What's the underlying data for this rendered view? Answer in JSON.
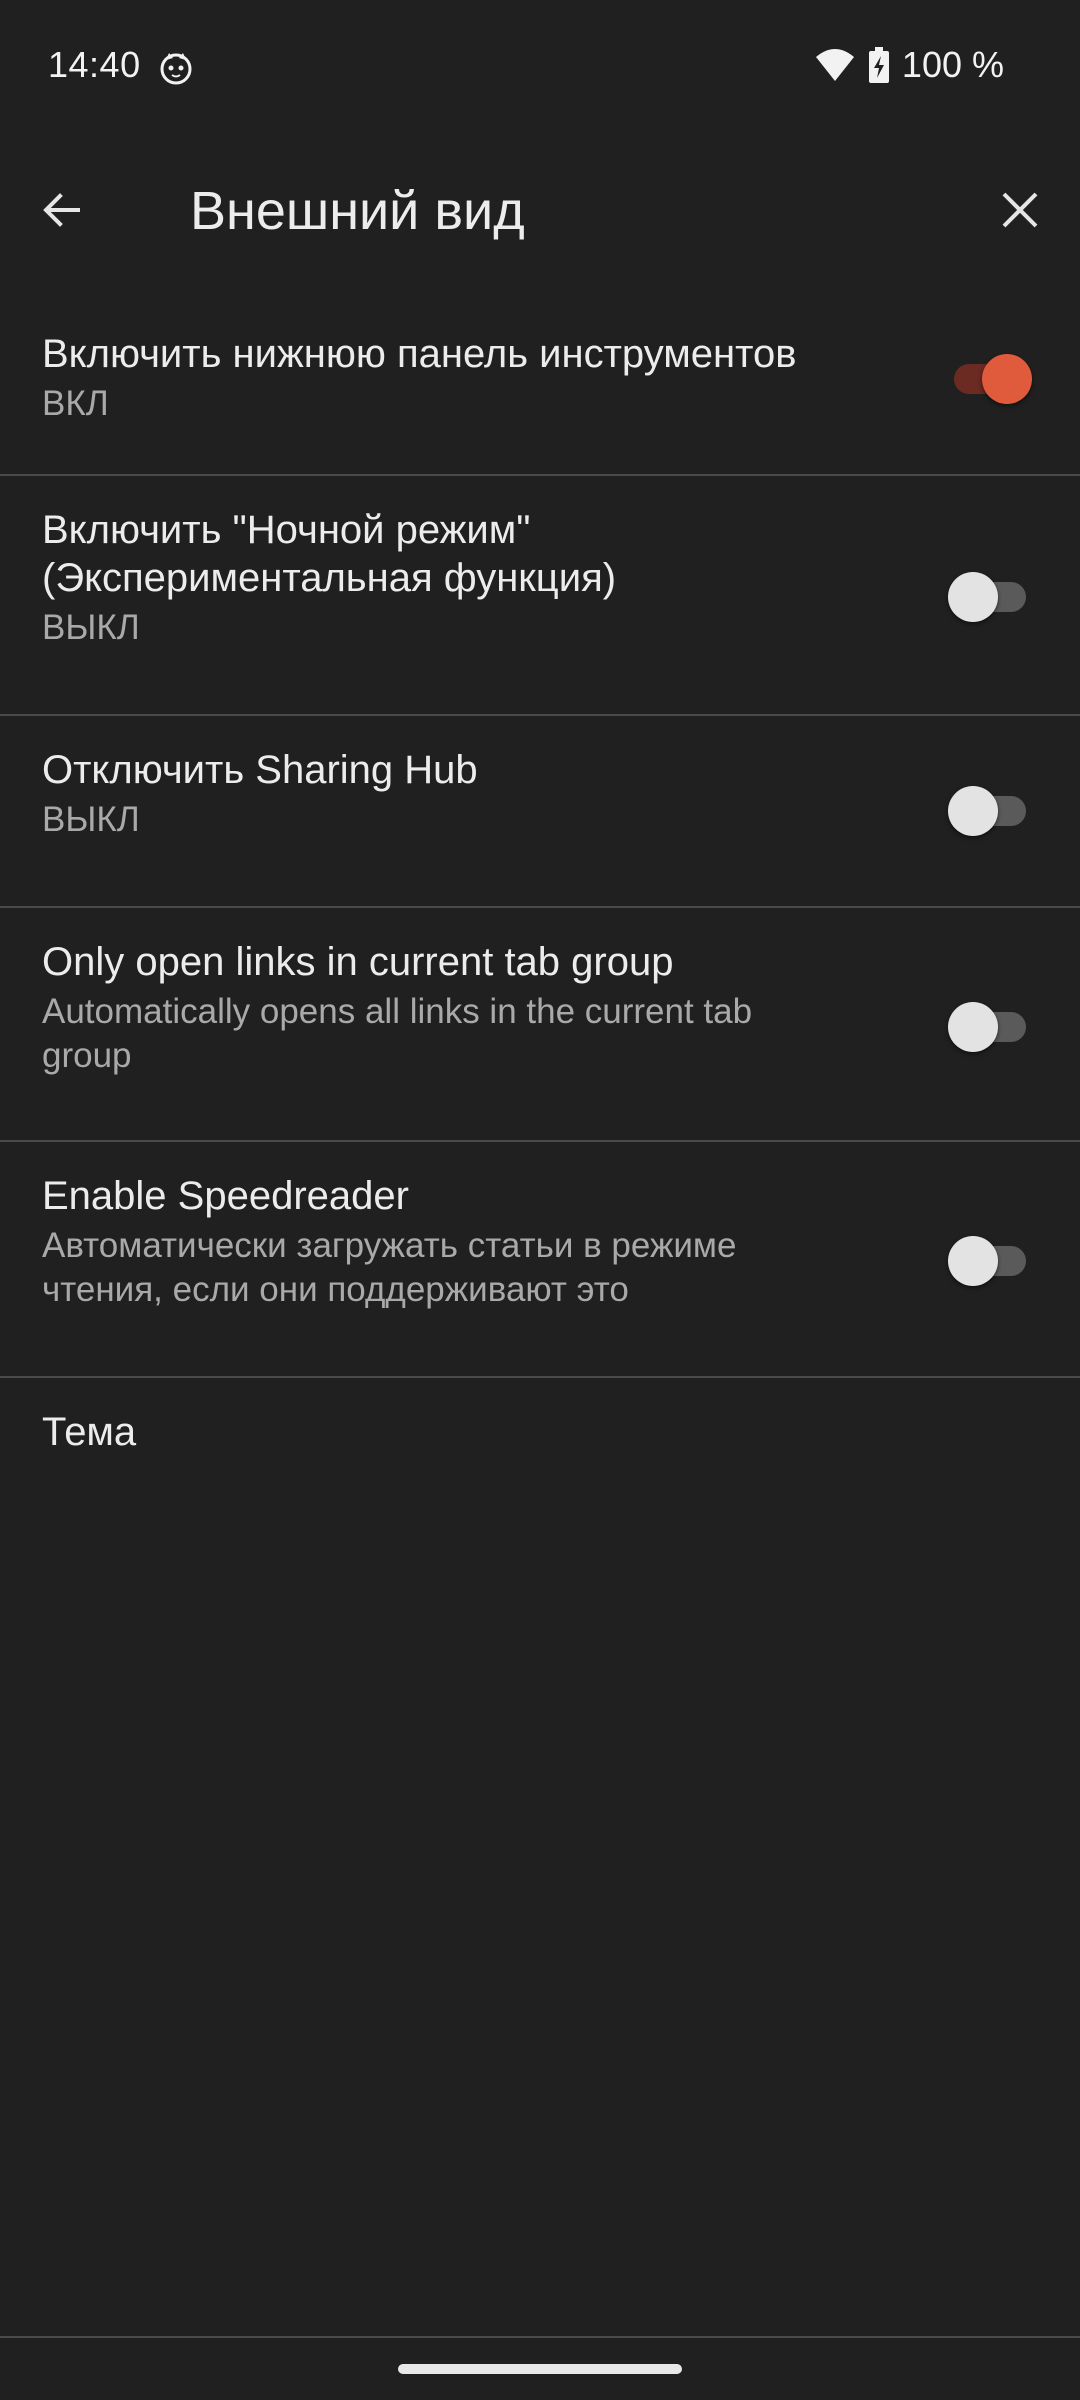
{
  "status_bar": {
    "time": "14:40",
    "notification_icon": "cat-face-icon",
    "wifi_icon": "wifi-icon",
    "battery_icon": "battery-charging-icon",
    "battery_percent": "100 %"
  },
  "toolbar": {
    "back_icon": "arrow-back-icon",
    "title": "Внешний вид",
    "close_icon": "close-icon"
  },
  "colors": {
    "background": "#202020",
    "accent": "#e05a3c",
    "divider": "#4a4a4a"
  },
  "settings": [
    {
      "title": "Включить нижнюю панель инструментов",
      "summary": "ВКЛ",
      "enabled": true
    },
    {
      "title": "Включить \"Ночной режим\" (Экспериментальная функция)",
      "summary": "ВЫКЛ",
      "enabled": false
    },
    {
      "title": "Отключить Sharing Hub",
      "summary": "ВЫКЛ",
      "enabled": false
    },
    {
      "title": "Only open links in current tab group",
      "summary": "Automatically opens all links in the current tab group",
      "enabled": false
    },
    {
      "title": "Enable Speedreader",
      "summary": "Автоматически загружать статьи в режиме чтения, если они поддерживают это",
      "enabled": false
    }
  ],
  "theme_item": {
    "title": "Тема"
  }
}
